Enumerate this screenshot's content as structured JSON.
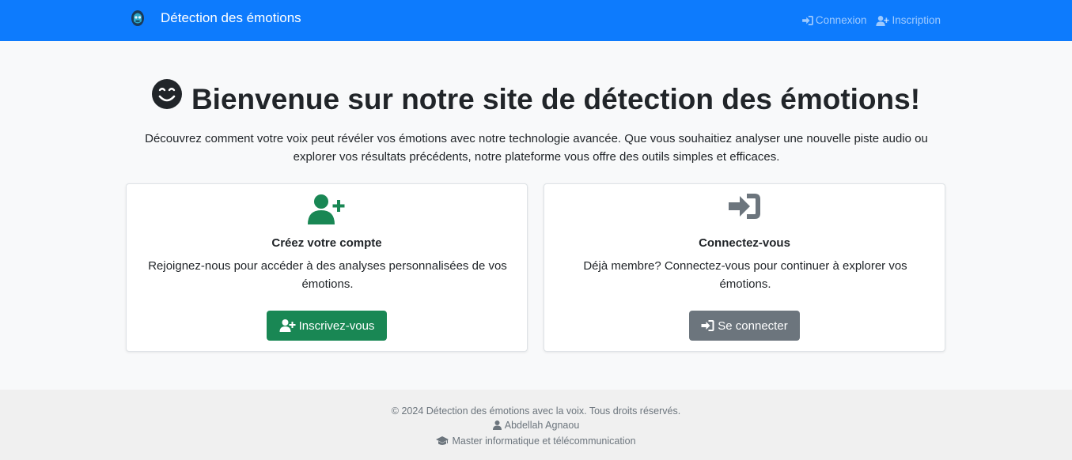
{
  "navbar": {
    "brand_logo_icon": "robot-head-logo",
    "brand_title": "Détection des émotions",
    "links": [
      {
        "label": "Connexion",
        "icon": "sign-in-icon"
      },
      {
        "label": "Inscription",
        "icon": "user-plus-icon"
      }
    ],
    "color": "#0d7bfd"
  },
  "hero": {
    "title": "Bienvenue sur notre site de détection des émotions!",
    "title_icon": "smiley-icon",
    "intro": "Découvrez comment votre voix peut révéler vos émotions avec notre technologie avancée. Que vous souhaitiez analyser une nouvelle piste audio ou explorer vos résultats précédents, notre plateforme vous offre des outils simples et efficaces."
  },
  "cards": {
    "register": {
      "icon": "user-plus-icon",
      "title": "Créez votre compte",
      "text": "Rejoignez-nous pour accéder à des analyses personnalisées de vos émotions.",
      "button_label": "Inscrivez-vous",
      "button_color": "#198754"
    },
    "login": {
      "icon": "sign-in-icon",
      "title": "Connectez-vous",
      "text": "Déjà membre? Connectez-vous pour continuer à explorer vos émotions.",
      "button_label": "Se connecter",
      "button_color": "#6c757d"
    }
  },
  "footer": {
    "copyright": "© 2024 Détection des émotions avec la voix. Tous droits réservés.",
    "author": "Abdellah Agnaou",
    "author_icon": "user-icon",
    "program": "Master informatique et télécommunication",
    "program_icon": "graduation-cap-icon"
  }
}
